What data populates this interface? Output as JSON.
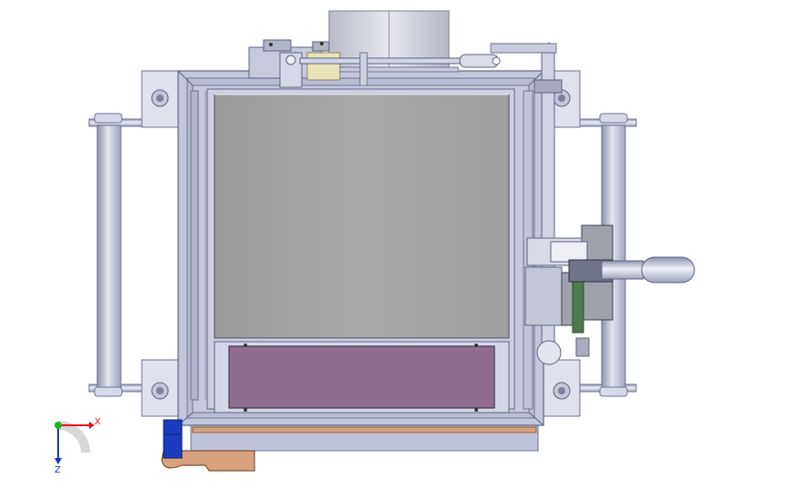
{
  "viewport": {
    "background": "#ffffff",
    "model_colors": {
      "frame": "#bfc4dc",
      "frame_dark": "#8e93ad",
      "panel": "#a3a3a3",
      "window": "#8f6d8f",
      "wood": "#d7a27e",
      "blue": "#1c3bbd",
      "rod": "#c9ccdd",
      "hub": "#4f7a4f",
      "motor": "#9fa2ab"
    }
  },
  "triad": {
    "x_label": "X",
    "z_label": "Z",
    "x_color": "#e0141b",
    "y_color": "#1fb21f",
    "z_color": "#1a36c8"
  }
}
